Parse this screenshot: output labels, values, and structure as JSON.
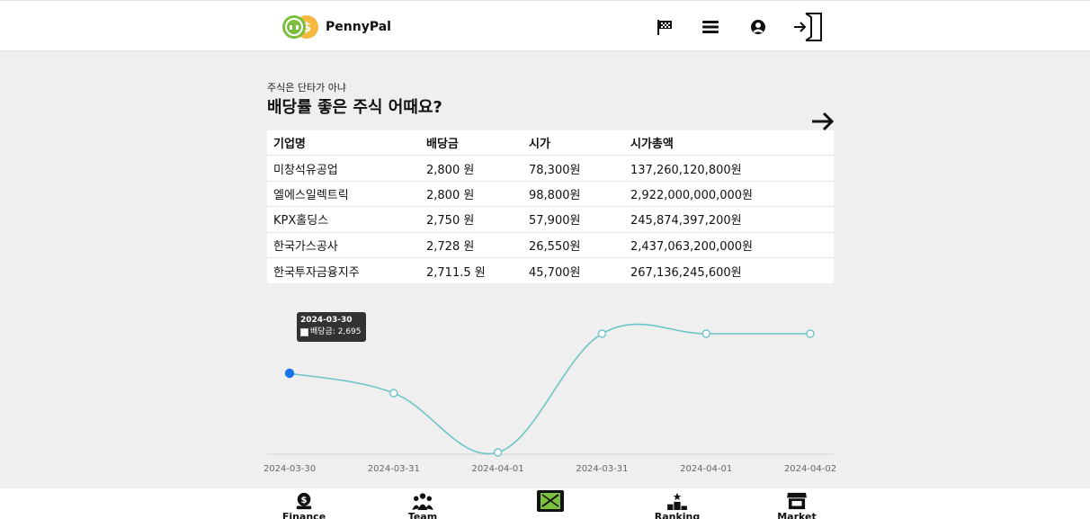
{
  "app": {
    "name": "PennyPal"
  },
  "header": {
    "icons": [
      "flag-icon",
      "menu-icon",
      "user-icon",
      "logout-icon"
    ]
  },
  "section": {
    "subtitle": "주식은 단타가 아냐",
    "title": "배당률 좋은 주식 어때요?"
  },
  "table": {
    "columns": [
      "기업명",
      "배당금",
      "시가",
      "시가총액"
    ],
    "rows": [
      [
        "미창석유공업",
        "2,800 원",
        "78,300원",
        "137,260,120,800원"
      ],
      [
        "엘에스일렉트릭",
        "2,800 원",
        "98,800원",
        "2,922,000,000,000원"
      ],
      [
        "KPX홀딩스",
        "2,750 원",
        "57,900원",
        "245,874,397,200원"
      ],
      [
        "한국가스공사",
        "2,728 원",
        "26,550원",
        "2,437,063,200,000원"
      ],
      [
        "한국투자금융지주",
        "2,711.5 원",
        "45,700원",
        "267,136,245,600원"
      ]
    ]
  },
  "chart_data": {
    "type": "line",
    "x": [
      "2024-03-30",
      "2024-03-31",
      "2024-04-01",
      "2024-03-31",
      "2024-04-01",
      "2024-04-02"
    ],
    "series": [
      {
        "name": "배당금",
        "values": [
          2695,
          2690,
          2675,
          2705,
          2705,
          2705
        ]
      }
    ],
    "ylim": [
      2675,
      2710
    ],
    "color": "#6cc5c7",
    "tooltip": {
      "date": "2024-03-30",
      "label": "배당금: 2,695"
    }
  },
  "bottom_nav": [
    {
      "label": "Finance",
      "icon": "money-bag-icon"
    },
    {
      "label": "Team",
      "icon": "team-icon"
    },
    {
      "label": "",
      "icon": "game-icon"
    },
    {
      "label": "Ranking",
      "icon": "podium-icon"
    },
    {
      "label": "Market",
      "icon": "store-icon"
    }
  ]
}
